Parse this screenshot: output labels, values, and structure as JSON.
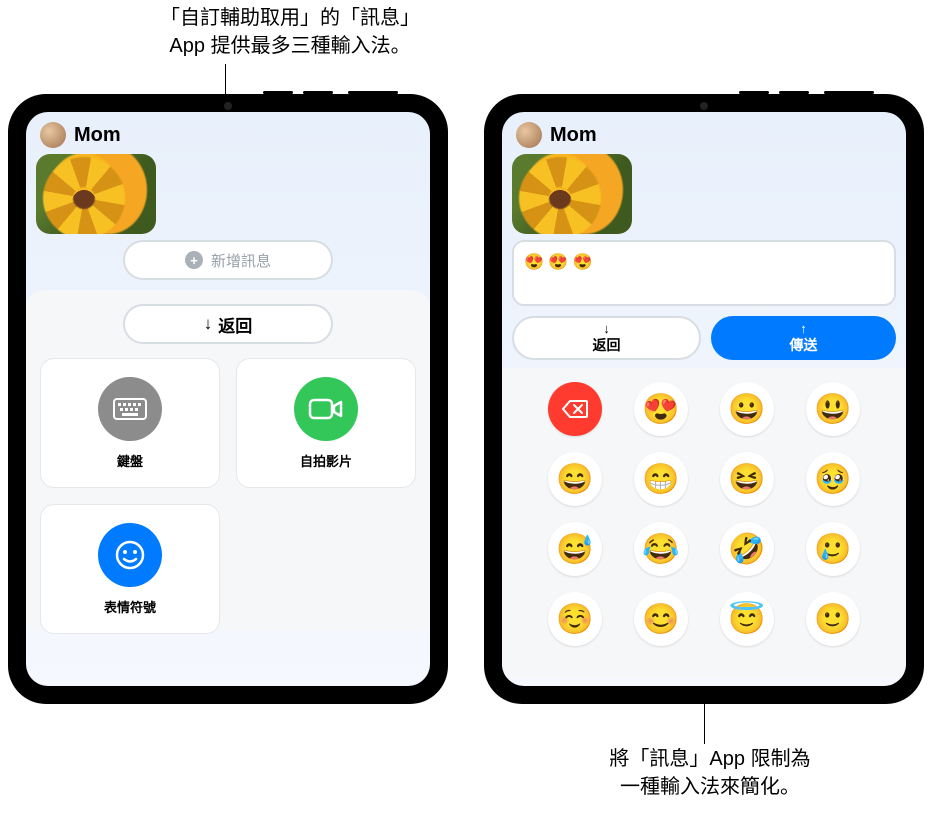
{
  "captions": {
    "top": "「自訂輔助取用」的「訊息」\nApp 提供最多三種輸入法。",
    "bottom": "將「訊息」App 限制為\n一種輸入法來簡化。"
  },
  "left": {
    "contact": "Mom",
    "new_message": "新增訊息",
    "back": "返回",
    "tiles": {
      "keyboard": "鍵盤",
      "video": "自拍影片",
      "emoji": "表情符號"
    }
  },
  "right": {
    "contact": "Mom",
    "input_value": "😍 😍 😍",
    "back": "返回",
    "send": "傳送",
    "emoji_keys": [
      "😍",
      "😀",
      "😃",
      "😄",
      "😁",
      "😆",
      "🥹",
      "😅",
      "😂",
      "🤣",
      "🥲",
      "☺️",
      "😊",
      "😇",
      "🙂"
    ]
  }
}
